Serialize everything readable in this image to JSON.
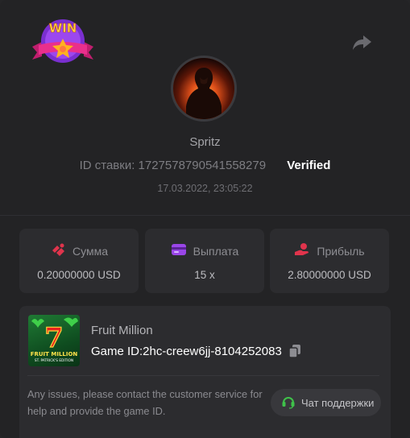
{
  "header": {
    "badge_text": "WIN",
    "username": "Spritz",
    "bet_id": "ID ставки: 1727578790541558279",
    "verified": "Verified",
    "datetime": "17.03.2022, 23:05:22"
  },
  "icons": [
    "win-badge-icon",
    "share-icon",
    "bet-amount-icon",
    "payout-card-icon",
    "profit-hand-icon",
    "copy-icon",
    "headset-icon"
  ],
  "stats": [
    {
      "label": "Сумма",
      "value": "0.20000000 USD",
      "icon": "bet-amount-icon",
      "color": "#e0344c"
    },
    {
      "label": "Выплата",
      "value": "15 x",
      "icon": "payout-card-icon",
      "color": "#9a46e8"
    },
    {
      "label": "Прибыль",
      "value": "2.80000000 USD",
      "icon": "profit-hand-icon",
      "color": "#e0344c"
    }
  ],
  "game": {
    "name": "Fruit Million",
    "id": "Game ID:2hc-creew6jj-8104252083",
    "thumb_title": "FRUIT MILLION",
    "thumb_subtitle": "ST. PATRICK'S EDITION",
    "thumb_number": "7"
  },
  "support": {
    "text": "Any issues, please contact the customer service for help and provide the game ID.",
    "button_label": "Чат поддержки"
  },
  "colors": {
    "background": "#232325",
    "card": "#2c2c2f",
    "accent_red": "#e0344c",
    "accent_purple": "#9a46e8",
    "accent_green": "#3fc24a"
  }
}
